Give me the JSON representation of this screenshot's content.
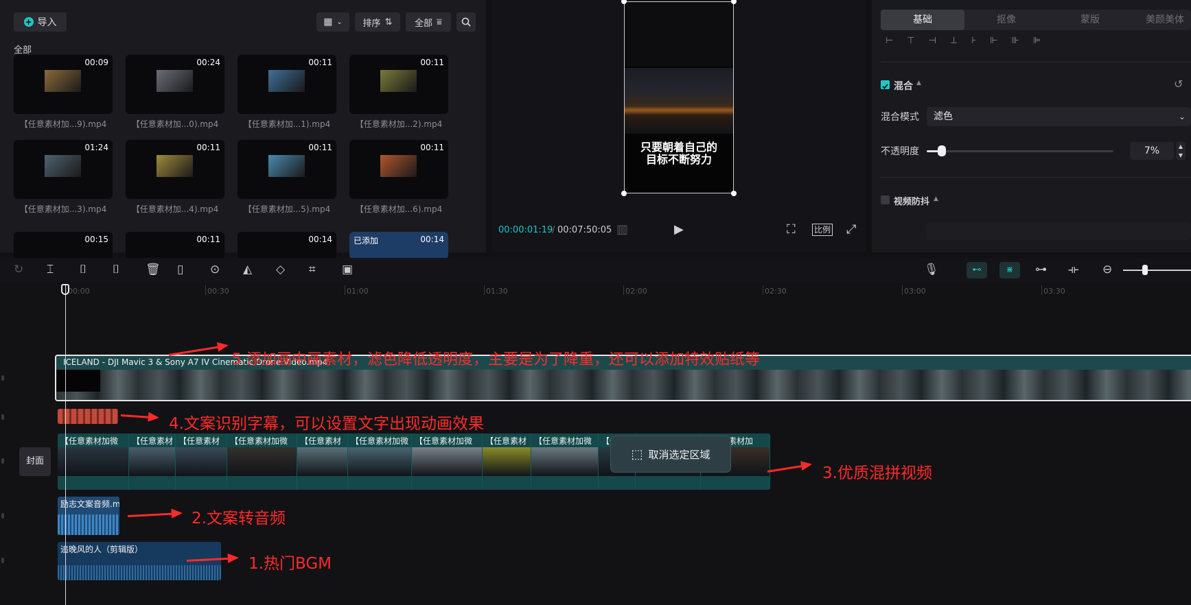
{
  "media": {
    "import_label": "导入",
    "sort_label": "排序",
    "filter_label": "全部",
    "category": "全部",
    "thumbs": [
      {
        "dur": "00:09",
        "name": "【任意素材加...9).mp4",
        "color": "#8a6a3a"
      },
      {
        "dur": "00:24",
        "name": "【任意素材加...0).mp4",
        "color": "#6a6e78"
      },
      {
        "dur": "00:11",
        "name": "【任意素材加...1).mp4",
        "color": "#3f6f9a"
      },
      {
        "dur": "00:11",
        "name": "【任意素材加...2).mp4",
        "color": "#7a7a3a"
      },
      {
        "dur": "01:24",
        "name": "【任意素材加...3).mp4",
        "color": "#4e6270"
      },
      {
        "dur": "00:11",
        "name": "【任意素材加...4).mp4",
        "color": "#a08a3a"
      },
      {
        "dur": "00:11",
        "name": "【任意素材加...5).mp4",
        "color": "#4a8ab0"
      },
      {
        "dur": "00:11",
        "name": "【任意素材加...6).mp4",
        "color": "#b0562a"
      },
      {
        "dur": "00:15",
        "name": "",
        "color": "#0a0a0c"
      },
      {
        "dur": "00:11",
        "name": "",
        "color": "#0a0a0c"
      },
      {
        "dur": "00:14",
        "name": "",
        "color": "#0a0a0c"
      },
      {
        "dur": "00:14",
        "name": "",
        "color": "#1d3c66",
        "added": "已添加"
      }
    ]
  },
  "player": {
    "caption_line1": "只要朝着自己的",
    "caption_line2": "目标不断努力",
    "current_time": "00:00:01:19",
    "total_time": "00:07:50:05",
    "ratio_label": "比例"
  },
  "properties": {
    "tabs": [
      "基础",
      "抠像",
      "蒙版",
      "美颜美体"
    ],
    "blend_label": "混合",
    "blend_mode_label": "混合模式",
    "blend_mode_value": "滤色",
    "opacity_label": "不透明度",
    "opacity_value": "7%",
    "opacity_fraction": 0.07,
    "stabilize_label": "视频防抖",
    "accent_color": "#1fc7c7"
  },
  "timeline": {
    "ruler": [
      "00:00",
      "00:30",
      "01:00",
      "01:30",
      "02:00",
      "02:30",
      "03:00",
      "03:30"
    ],
    "overlay_clip_label": "ICELAND - DJI Mavic 3 & Sony A7 IV  Cinematic Drone Video.mp4",
    "cover_label": "封面",
    "main_segments": [
      "【任意素材加微",
      "【任意素材",
      "【任意素材",
      "【任意素材加微",
      "【任意素材",
      "【任意素材加微",
      "【任意素材加微",
      "【任意素材",
      "【任意素材加微",
      "【任意素材",
      "【任意素材",
      "【任意素材加"
    ],
    "tts_clip_label": "励志文案音频.m",
    "bgm_clip_label": "追晚风的人（剪辑版）",
    "tooltip_label": "取消选定区域"
  },
  "annotations": [
    "5.添加画中画素材，滤色降低透明度，主要是为了降重，还可以添加特效贴纸等",
    "4.文案识别字幕，可以设置文字出现动画效果",
    "3.优质混拼视频",
    "2.文案转音频",
    "1.热门BGM"
  ]
}
